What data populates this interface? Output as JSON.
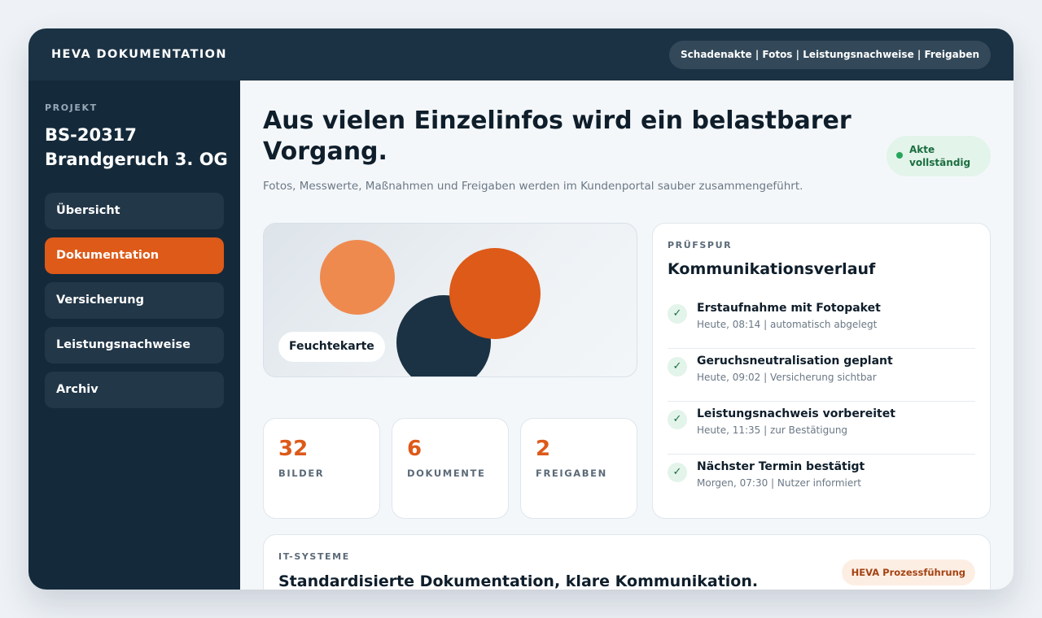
{
  "header": {
    "brand": "HEVA DOKUMENTATION",
    "nav": "Schadenakte | Fotos | Leistungsnachweise | Freigaben"
  },
  "sidebar": {
    "project_label": "PROJEKT",
    "project_title": "BS-20317 Brandgeruch 3. OG",
    "items": [
      {
        "label": "Übersicht",
        "active": false
      },
      {
        "label": "Dokumentation",
        "active": true
      },
      {
        "label": "Versicherung",
        "active": false
      },
      {
        "label": "Leistungsnachweise",
        "active": false
      },
      {
        "label": "Archiv",
        "active": false
      }
    ]
  },
  "main": {
    "headline": "Aus vielen Einzelinfos wird ein belastbarer Vorgang.",
    "subline": "Fotos, Messwerte, Maßnahmen und Freigaben werden im Kundenportal sauber zusammengeführt.",
    "status": "Akte vollständig",
    "hero_tag": "Feuchtekarte",
    "stats": [
      {
        "value": "32",
        "label": "BILDER"
      },
      {
        "value": "6",
        "label": "DOKUMENTE"
      },
      {
        "value": "2",
        "label": "FREIGABEN"
      }
    ]
  },
  "trail": {
    "kicker": "PRÜFSPUR",
    "title": "Kommunikationsverlauf",
    "items": [
      {
        "title": "Erstaufnahme mit Fotopaket",
        "meta": "Heute, 08:14 | automatisch abgelegt"
      },
      {
        "title": "Geruchsneutralisation geplant",
        "meta": "Heute, 09:02 | Versicherung sichtbar"
      },
      {
        "title": "Leistungsnachweis vorbereitet",
        "meta": "Heute, 11:35 | zur Bestätigung"
      },
      {
        "title": "Nächster Termin bestätigt",
        "meta": "Morgen, 07:30 | Nutzer informiert"
      }
    ]
  },
  "it": {
    "kicker": "IT-SYSTEME",
    "title": "Standardisierte Dokumentation, klare Kommunikation.",
    "badge": "HEVA Prozessführung"
  },
  "icons": {
    "check": "check-icon",
    "status_dot": "status-dot-icon"
  },
  "colors": {
    "navy": "#1b3244",
    "accent": "#dd5a19",
    "success": "#26a65b"
  }
}
